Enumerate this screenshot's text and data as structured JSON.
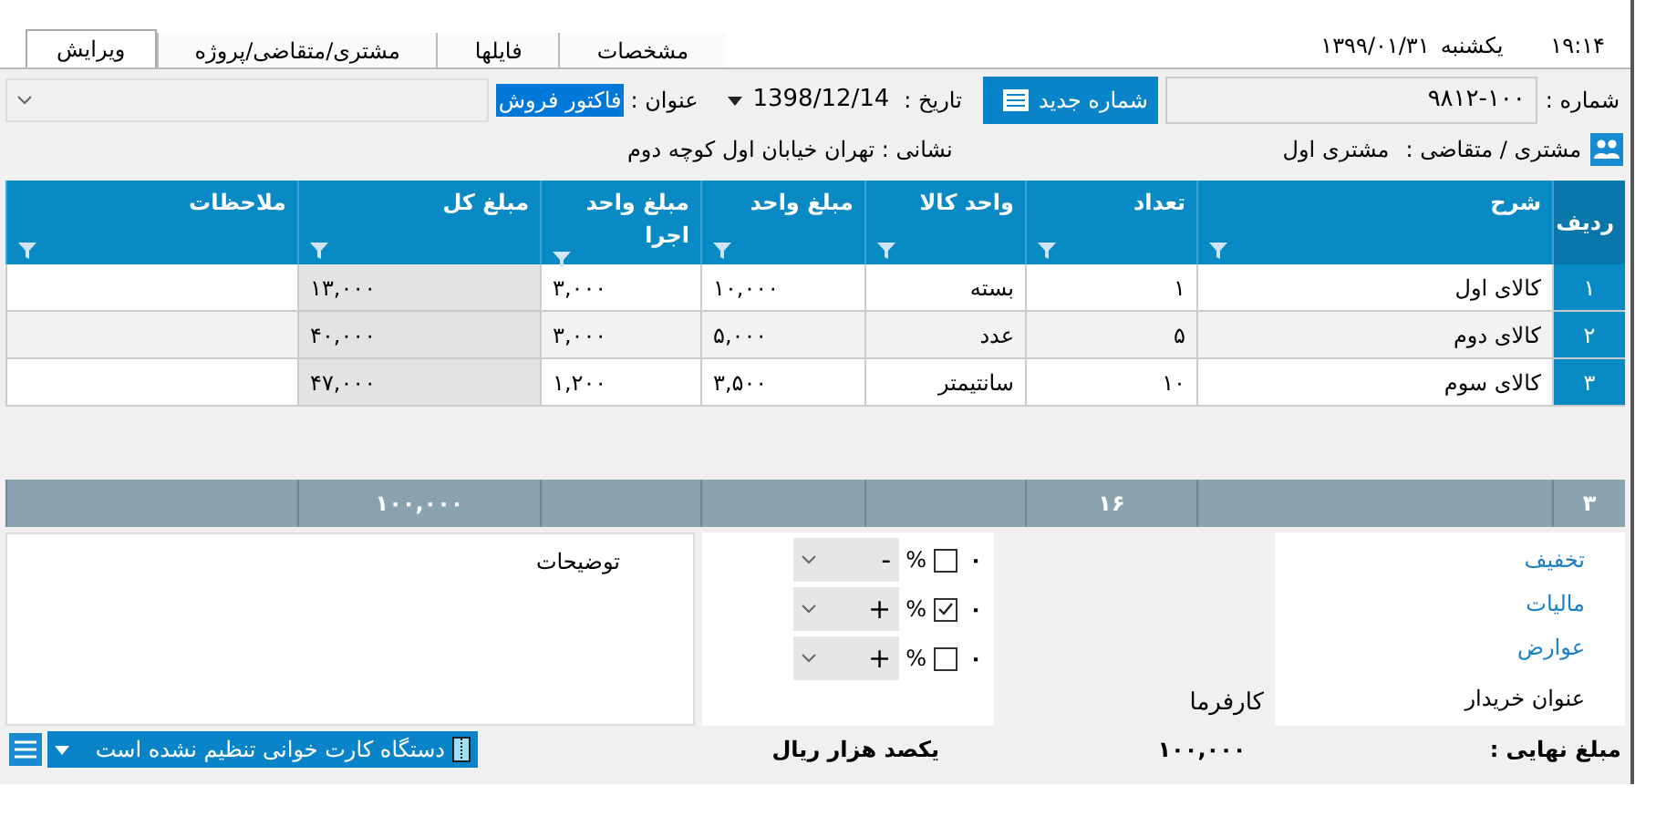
{
  "tabs": [
    {
      "label": "مشخصات",
      "selected": false
    },
    {
      "label": "فایلها",
      "selected": false
    },
    {
      "label": "مشتری/متقاضی/پروژه",
      "selected": false
    },
    {
      "label": "ویرایش",
      "selected": true
    }
  ],
  "clock": {
    "day": "یکشنبه",
    "date": "۱۳۹۹/۰۱/۳۱",
    "time": "۱۹:۱۴"
  },
  "header": {
    "number_label": "شماره :",
    "number": "۹۸۱۲-۱۰۰",
    "new_number_button": "شماره جدید",
    "date_label": "تاریخ :",
    "date": "1398/12/14",
    "title_label": "عنوان :",
    "title": "فاکتور فروش",
    "customer_label": "مشتری / متقاضی :",
    "customer": "مشتری اول",
    "address": "نشانی : تهران خیابان اول کوچه دوم"
  },
  "table": {
    "columns": [
      {
        "label": "ردیف",
        "filter": false
      },
      {
        "label": "شرح",
        "filter": true
      },
      {
        "label": "تعداد",
        "filter": true
      },
      {
        "label": "واحد کالا",
        "filter": true
      },
      {
        "label": "مبلغ واحد",
        "filter": true
      },
      {
        "label": "مبلغ واحد اجرا",
        "filter": true
      },
      {
        "label": "مبلغ کل",
        "filter": true
      },
      {
        "label": "ملاحظات",
        "filter": true
      }
    ],
    "rows": [
      [
        "۱",
        "کالای اول",
        "۱",
        "بسته",
        "۱۰,۰۰۰",
        "۳,۰۰۰",
        "۱۳,۰۰۰",
        ""
      ],
      [
        "۲",
        "کالای دوم",
        "۵",
        "عدد",
        "۵,۰۰۰",
        "۳,۰۰۰",
        "۴۰,۰۰۰",
        ""
      ],
      [
        "۳",
        "کالای سوم",
        "۱۰",
        "سانتیمتر",
        "۳,۵۰۰",
        "۱,۲۰۰",
        "۴۷,۰۰۰",
        ""
      ]
    ],
    "totals": {
      "row_count": "۳",
      "quantity": "۱۶",
      "amount": "۱۰۰,۰۰۰"
    }
  },
  "adjustments": [
    {
      "label": "تخفیف",
      "value": "۰",
      "checked": false,
      "sign": "-"
    },
    {
      "label": "مالیات",
      "value": "۰",
      "checked": true,
      "sign": "+"
    },
    {
      "label": "عوارض",
      "value": "۰",
      "checked": false,
      "sign": "+"
    }
  ],
  "percent": "%",
  "buyer_title_label": "عنوان خریدار",
  "buyer_title": "کارفرما",
  "notes_placeholder": "توضیحات",
  "final": {
    "label": "مبلغ نهایی :",
    "amount": "۱۰۰,۰۰۰",
    "words": "یکصد هزار ریال"
  },
  "card_reader": "دستگاه کارت خوانی تنظیم نشده است"
}
